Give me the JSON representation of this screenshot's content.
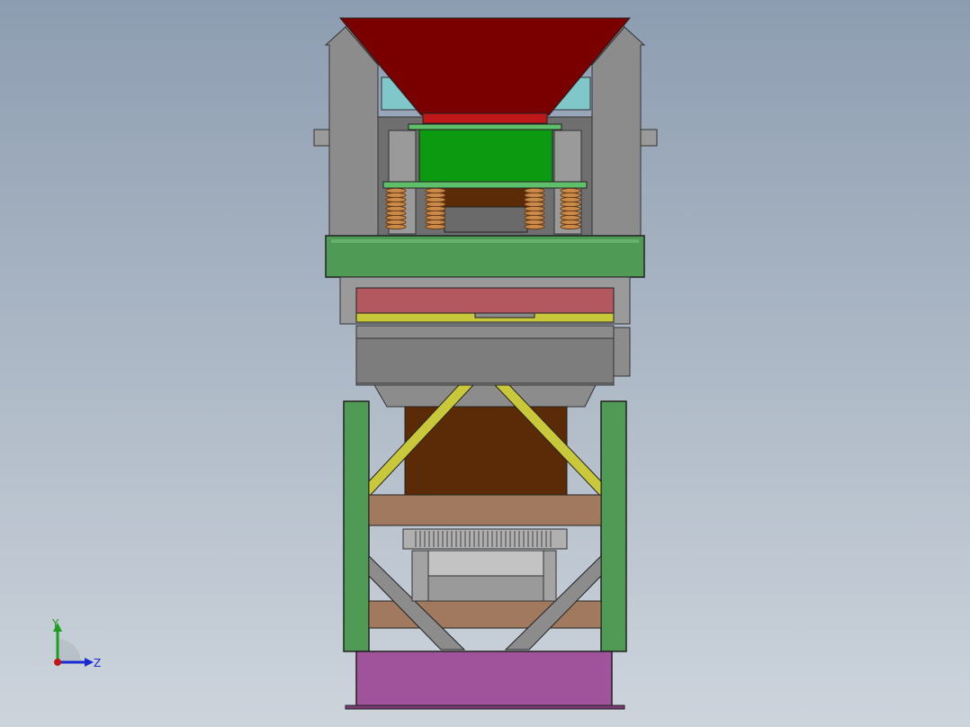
{
  "viewport": {
    "background_top": "#8d9db1",
    "background_bottom": "#cdd4dc"
  },
  "model": {
    "name": "machine-assembly-front-view",
    "colors": {
      "hopper": "#7a0000",
      "hopper_rim": "#c01818",
      "green_block": "#0c9a10",
      "frame_green": "#4f9a55",
      "gray_panel": "#8c8c8c",
      "cyan_panel": "#7fc7c9",
      "spring": "#c98a4a",
      "pink_plate": "#b3585e",
      "yellow_brace": "#c9c73a",
      "brown_box": "#5a2b06",
      "tan_beam": "#a0795e",
      "purple_base": "#a0529a"
    }
  },
  "triad": {
    "y_label": "Y",
    "z_label": "Z",
    "y_color": "#1aa01a",
    "z_color": "#1a2ad0",
    "origin_color": "#c01818"
  }
}
